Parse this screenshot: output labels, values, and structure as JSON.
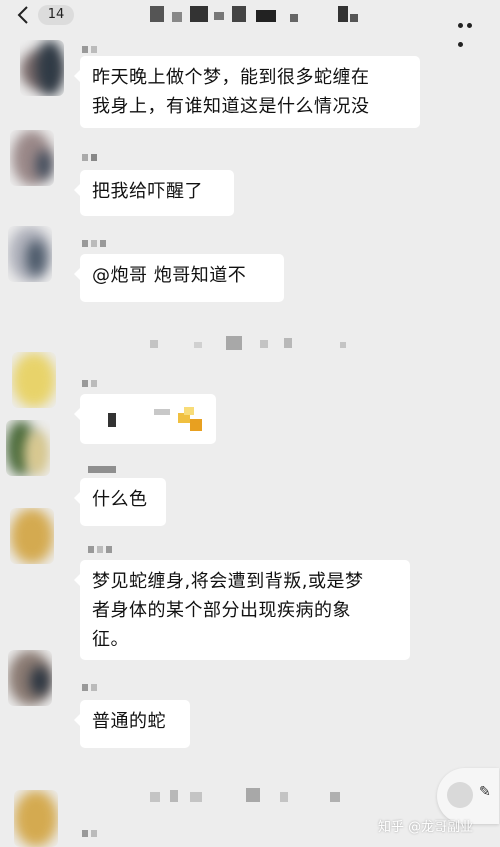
{
  "header": {
    "unread_count": "14"
  },
  "messages": [
    {
      "text": "昨天晚上做个梦，能到很多蛇缠在\n我身上，有谁知道这是什么情况没"
    },
    {
      "text": "把我给吓醒了"
    },
    {
      "text": "@炮哥  炮哥知道不"
    },
    {
      "text": "什么色"
    },
    {
      "text": "梦见蛇缠身,将会遭到背叛,或是梦\n者身体的某个部分出现疾病的象\n征。"
    },
    {
      "text": "普通的蛇"
    }
  ],
  "watermark": "知乎 @龙哥副业",
  "colors": {
    "background": "#ededed",
    "bubble": "#ffffff"
  }
}
